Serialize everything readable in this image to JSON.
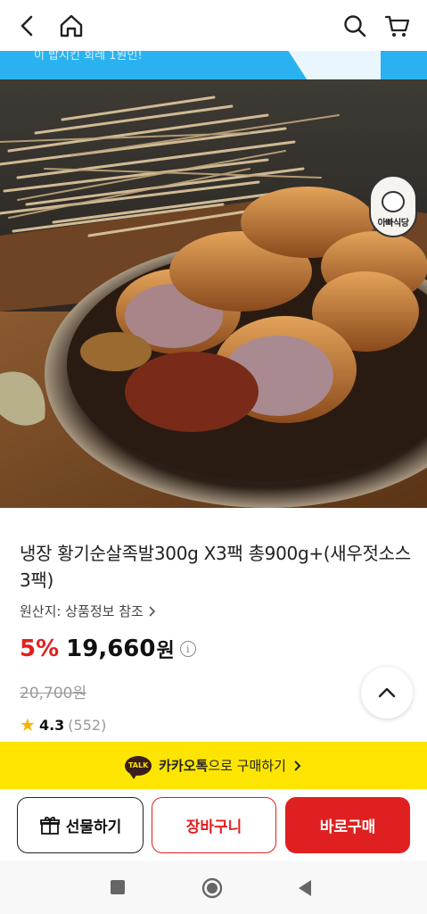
{
  "nav": {
    "back_icon": "back-arrow-icon",
    "home_icon": "home-icon",
    "search_icon": "search-icon",
    "cart_icon": "cart-icon"
  },
  "banner": {
    "text": "이 밥시킨 회레 1원인!",
    "color": "#2ab2f0"
  },
  "hero": {
    "brand_badge_label": "아빠식당"
  },
  "product": {
    "title": "냉장 황기순살족발300g X3팩 총900g+(새우젓소스 3팩)",
    "origin_label": "원산지: 상품정보 참조",
    "discount": "5%",
    "price": "19,660",
    "currency": "원",
    "original_price": "20,700원",
    "rating": "4.3",
    "review_count": "(552)"
  },
  "kakao": {
    "badge": "TALK",
    "label_bold": "카카오톡",
    "label_rest": "으로 구매하기",
    "color": "#fde500"
  },
  "actions": {
    "gift_label": "선물하기",
    "cart_label": "장바구니",
    "buy_label": "바로구매",
    "accent_color": "#e02020"
  },
  "system_nav": {
    "recents_icon": "recents-square-icon",
    "home_icon": "home-circle-icon",
    "back_icon": "back-triangle-icon"
  }
}
